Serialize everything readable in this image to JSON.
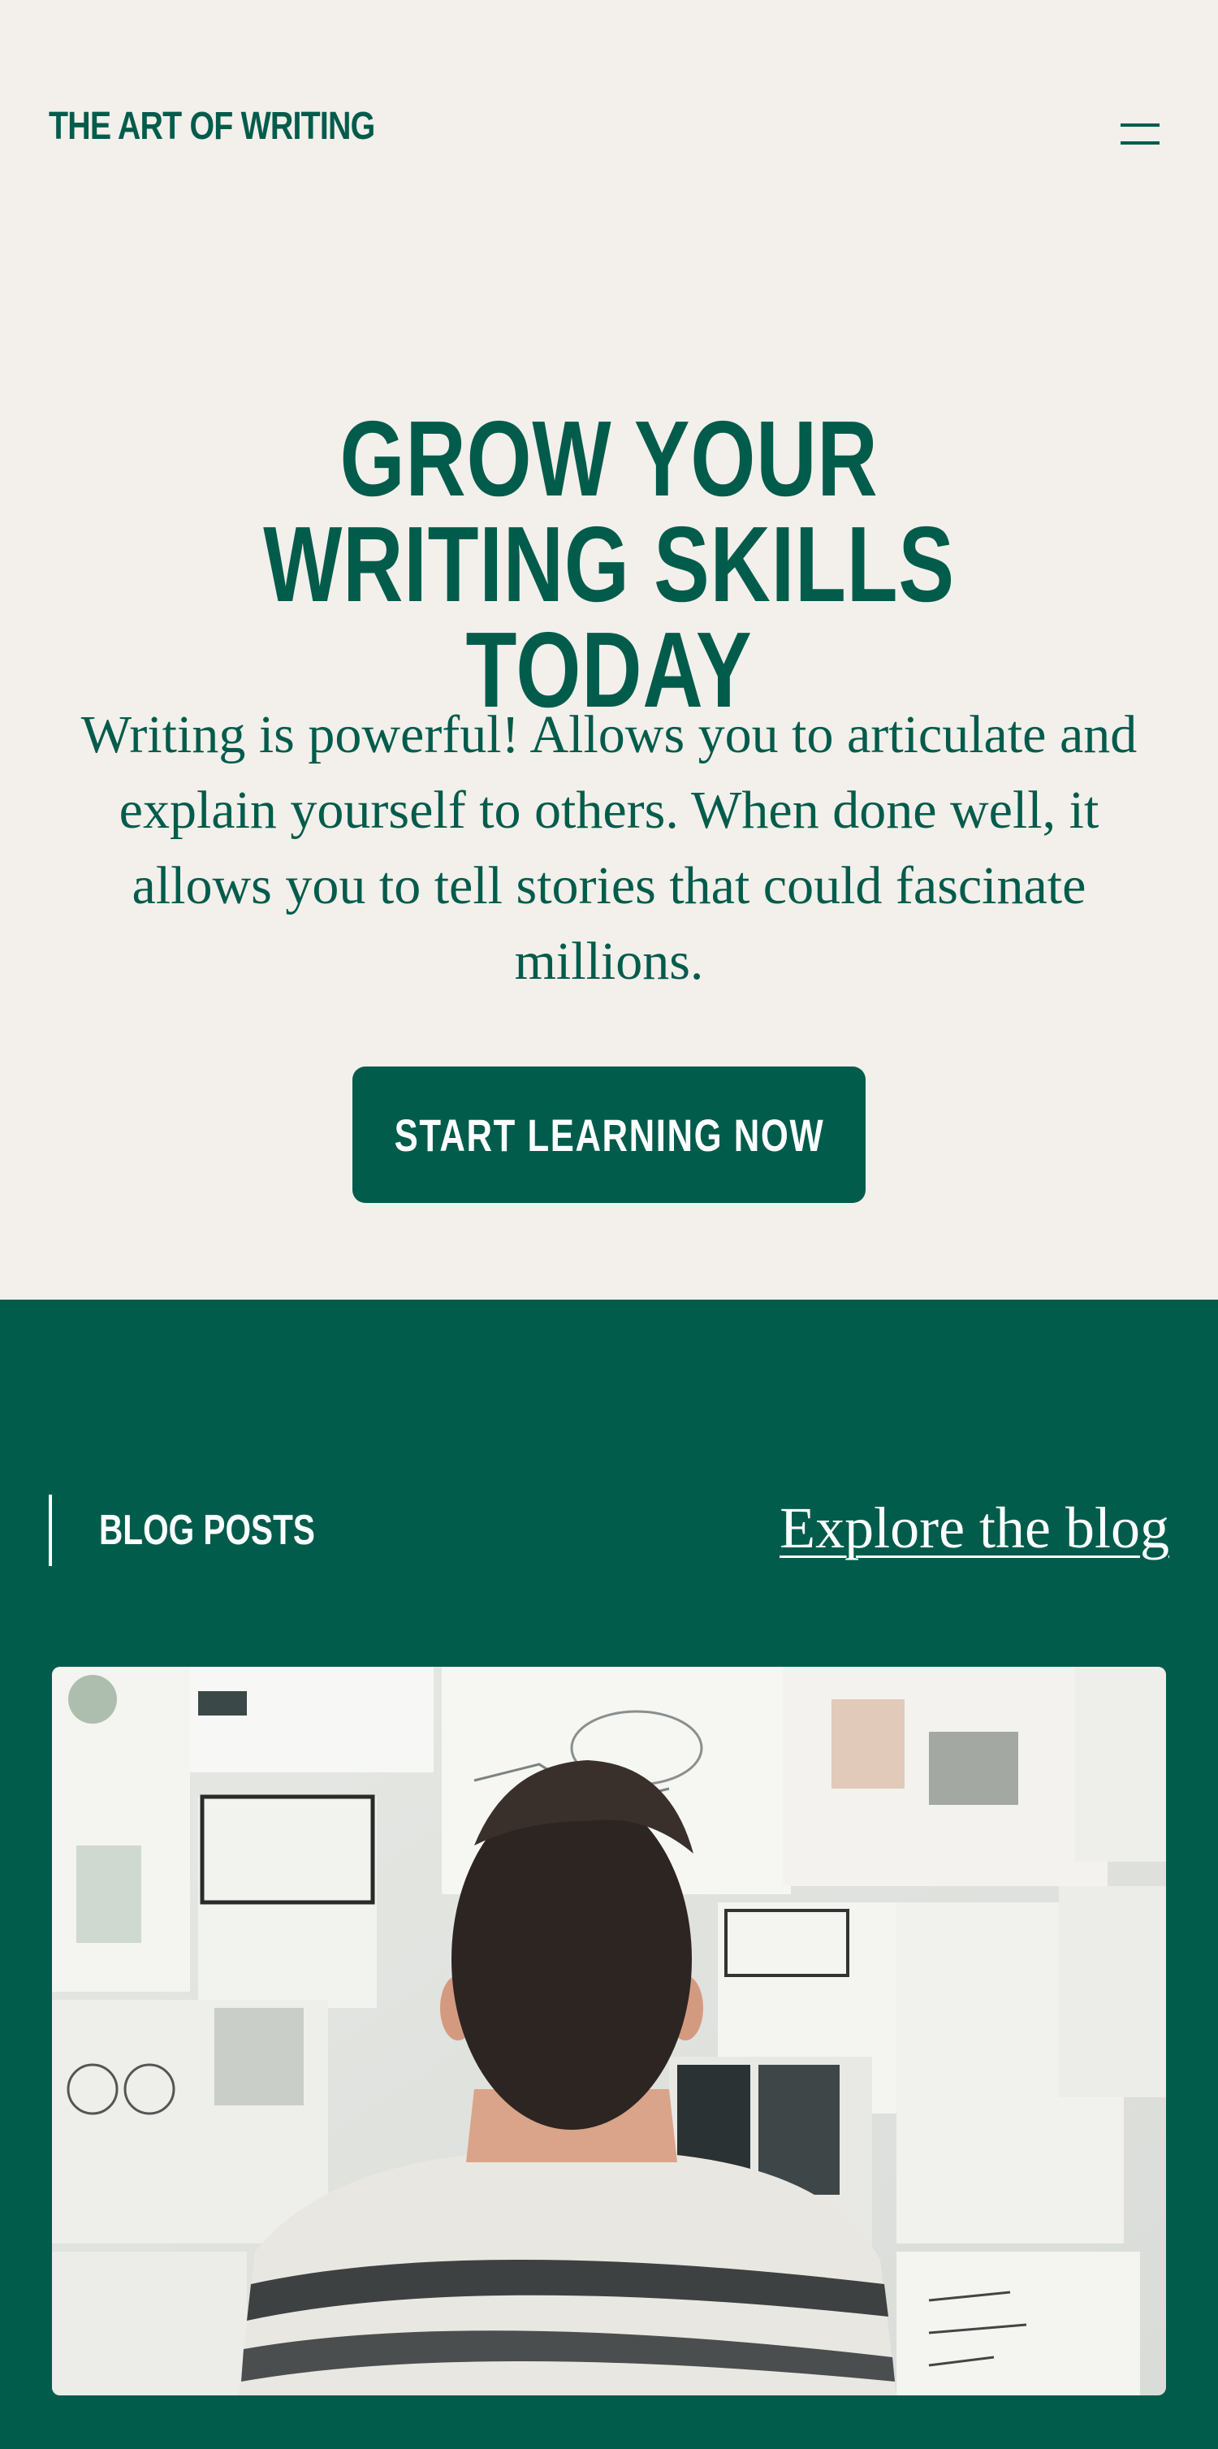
{
  "header": {
    "logo": "THE ART OF WRITING",
    "menu_icon": "hamburger-menu-icon"
  },
  "hero": {
    "title": "GROW YOUR WRITING SKILLS TODAY",
    "text": "Writing is powerful! Allows you to articulate and explain yourself to others. When done well, it allows you to tell stories that could fascinate millions.",
    "cta_label": "START LEARNING NOW"
  },
  "blog": {
    "heading": "BLOG POSTS",
    "explore_label": "Explore the blog",
    "featured_image": "person-looking-at-pinned-sketches-wall"
  },
  "colors": {
    "background": "#f3efea",
    "brand_green": "#025c4c",
    "white": "#ffffff"
  }
}
